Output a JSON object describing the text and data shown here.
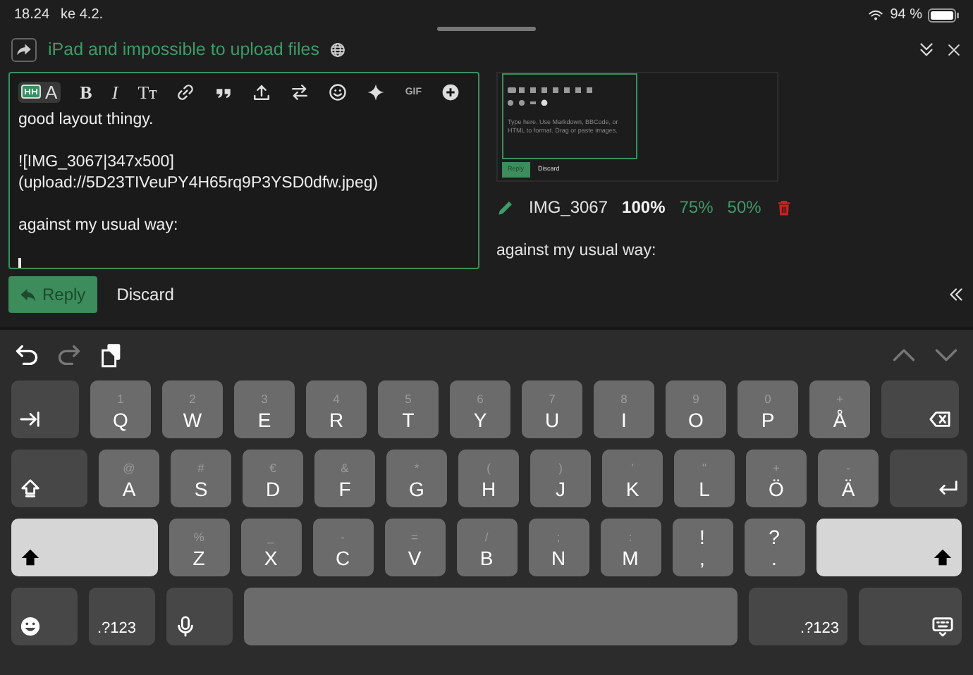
{
  "status_bar": {
    "time": "18.24",
    "date": "ke 4.2.",
    "battery": "94 %"
  },
  "topic": {
    "title": "iPad and impossible to upload files"
  },
  "composer": {
    "toolbar": [
      {
        "kind": "toggle",
        "label": "A",
        "selected": true
      },
      {
        "kind": "bold",
        "label": "B"
      },
      {
        "kind": "italic",
        "label": "I"
      },
      {
        "kind": "heading",
        "label": "Tт"
      },
      {
        "kind": "link"
      },
      {
        "kind": "quote"
      },
      {
        "kind": "upload"
      },
      {
        "kind": "swap"
      },
      {
        "kind": "emoji"
      },
      {
        "kind": "sparkle"
      },
      {
        "kind": "gif",
        "label": "GIF"
      },
      {
        "kind": "plus"
      }
    ],
    "paragraphs": [
      [
        "good layout thingy."
      ],
      [
        "![IMG_3067|347x500]",
        "(upload://5D23TIVeuPY4H65rq9P3YSD0dfw.jpeg)"
      ],
      [
        "against my usual way:"
      ]
    ]
  },
  "preview": {
    "image": {
      "placeholder": "Type here. Use Markdown, BBCode, or HTML to format. Drag or paste images.",
      "reply": "Reply",
      "discard": "Discard"
    },
    "image_name": "IMG_3067",
    "sizes": [
      {
        "label": "100%",
        "selected": true
      },
      {
        "label": "75%",
        "selected": false
      },
      {
        "label": "50%",
        "selected": false
      }
    ],
    "text": "against my usual way:"
  },
  "actions": {
    "reply": "Reply",
    "discard": "Discard"
  },
  "keyboard": {
    "shortcuts": [
      {
        "kind": "undo",
        "disabled": false
      },
      {
        "kind": "redo",
        "disabled": true
      },
      {
        "kind": "paste",
        "disabled": false
      }
    ],
    "nav": [
      {
        "kind": "up",
        "disabled": true
      },
      {
        "kind": "down",
        "disabled": true
      }
    ],
    "top_row": [
      {
        "kind": "tab"
      },
      {
        "kind": "letter",
        "label": "Q",
        "alt": "1"
      },
      {
        "kind": "letter",
        "label": "W",
        "alt": "2"
      },
      {
        "kind": "letter",
        "label": "E",
        "alt": "3"
      },
      {
        "kind": "letter",
        "label": "R",
        "alt": "4"
      },
      {
        "kind": "letter",
        "label": "T",
        "alt": "5"
      },
      {
        "kind": "letter",
        "label": "Y",
        "alt": "6"
      },
      {
        "kind": "letter",
        "label": "U",
        "alt": "7"
      },
      {
        "kind": "letter",
        "label": "I",
        "alt": "8"
      },
      {
        "kind": "letter",
        "label": "O",
        "alt": "9"
      },
      {
        "kind": "letter",
        "label": "P",
        "alt": "0"
      },
      {
        "kind": "letter",
        "label": "Å",
        "alt": "+"
      },
      {
        "kind": "backspace"
      }
    ],
    "home_row": [
      {
        "kind": "capslock"
      },
      {
        "kind": "letter",
        "label": "A",
        "alt": "@"
      },
      {
        "kind": "letter",
        "label": "S",
        "alt": "#"
      },
      {
        "kind": "letter",
        "label": "D",
        "alt": "€"
      },
      {
        "kind": "letter",
        "label": "F",
        "alt": "&"
      },
      {
        "kind": "letter",
        "label": "G",
        "alt": "*"
      },
      {
        "kind": "letter",
        "label": "H",
        "alt": "("
      },
      {
        "kind": "letter",
        "label": "J",
        "alt": ")"
      },
      {
        "kind": "letter",
        "label": "K",
        "alt": "'"
      },
      {
        "kind": "letter",
        "label": "L",
        "alt": "\""
      },
      {
        "kind": "letter",
        "label": "Ö",
        "alt": "+"
      },
      {
        "kind": "letter",
        "label": "Ä",
        "alt": "-"
      },
      {
        "kind": "return"
      }
    ],
    "bottom_row": [
      {
        "kind": "shift",
        "on": true
      },
      {
        "kind": "letter",
        "label": "Z",
        "alt": "%"
      },
      {
        "kind": "letter",
        "label": "X",
        "alt": "_"
      },
      {
        "kind": "letter",
        "label": "C",
        "alt": "-"
      },
      {
        "kind": "letter",
        "label": "V",
        "alt": "="
      },
      {
        "kind": "letter",
        "label": "B",
        "alt": "/"
      },
      {
        "kind": "letter",
        "label": "N",
        "alt": ";"
      },
      {
        "kind": "letter",
        "label": "M",
        "alt": ":"
      },
      {
        "kind": "punct",
        "label": ",",
        "alt": "!"
      },
      {
        "kind": "punct",
        "label": ".",
        "alt": "?"
      },
      {
        "kind": "shift",
        "on": true
      }
    ],
    "space_row": [
      {
        "kind": "emoji"
      },
      {
        "kind": "numbers",
        "label": ".?123"
      },
      {
        "kind": "mic"
      },
      {
        "kind": "space"
      },
      {
        "kind": "numbers",
        "label": ".?123"
      },
      {
        "kind": "dismiss"
      }
    ]
  }
}
